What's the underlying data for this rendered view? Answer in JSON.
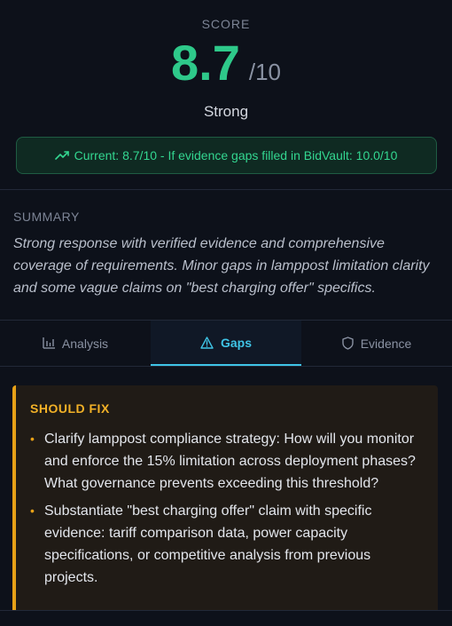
{
  "score": {
    "label": "SCORE",
    "value": "8.7",
    "max": "/10",
    "rating": "Strong",
    "projection": "Current: 8.7/10 - If evidence gaps filled in BidVault: 10.0/10",
    "projection_icon": "trending-up-icon"
  },
  "summary": {
    "label": "SUMMARY",
    "text": "Strong response with verified evidence and comprehensive coverage of requirements. Minor gaps in lamppost limitation clarity and some vague claims on \"best charging offer\" specifics."
  },
  "tabs": [
    {
      "label": "Analysis",
      "icon": "bar-chart-icon",
      "active": false
    },
    {
      "label": "Gaps",
      "icon": "warning-triangle-icon",
      "active": true
    },
    {
      "label": "Evidence",
      "icon": "shield-icon",
      "active": false
    }
  ],
  "gaps": {
    "title": "SHOULD FIX",
    "items": [
      "Clarify lamppost compliance strategy: How will you monitor and enforce the 15% limitation across deployment phases? What governance prevents exceeding this threshold?",
      "Substantiate \"best charging offer\" claim with specific evidence: tariff comparison data, power capacity specifications, or competitive analysis from previous projects."
    ]
  },
  "colors": {
    "accent_green": "#2ec98a",
    "accent_cyan": "#3fc4e6",
    "warning_amber": "#e8a117",
    "background": "#0d111a"
  }
}
